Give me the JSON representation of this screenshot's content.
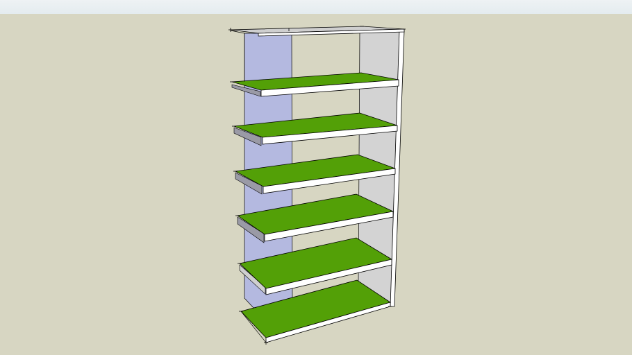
{
  "viewport": {
    "background_color": "#d7d6c2",
    "sky_color": "#e8eef0"
  },
  "model": {
    "subject": "shelving-unit",
    "shelf_count": 6,
    "colors": {
      "shelf_top": "#53a007",
      "shelf_edge": "#ffffff",
      "shelf_shadow": "#9a9aa6",
      "back_panel": "#b4b9e0",
      "side_panel": "#d3d3d3",
      "frame_edge": "#ffffff",
      "outline": "#000000"
    }
  }
}
